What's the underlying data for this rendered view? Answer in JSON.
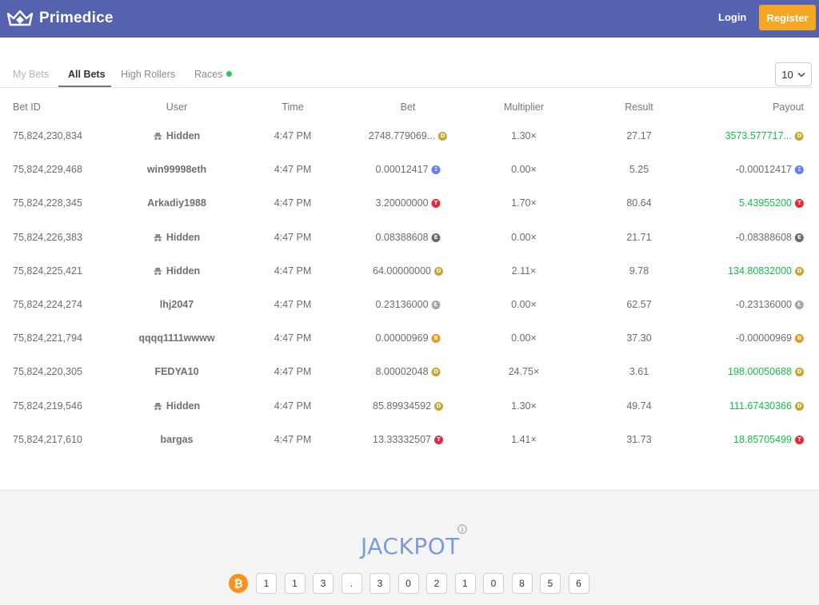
{
  "header": {
    "brand": "Primedice",
    "login_label": "Login",
    "register_label": "Register",
    "bar_color": "#5562ad",
    "register_color": "#f5a623"
  },
  "tabs": [
    {
      "label": "My Bets",
      "state": "disabled"
    },
    {
      "label": "All Bets",
      "state": "active"
    },
    {
      "label": "High Rollers",
      "state": "normal"
    },
    {
      "label": "Races",
      "state": "normal",
      "live_indicator": true
    }
  ],
  "rows_selector": {
    "value": "10",
    "icon": "chevron-down-icon"
  },
  "table": {
    "columns": [
      "Bet ID",
      "User",
      "Time",
      "Bet",
      "Multiplier",
      "Result",
      "Payout"
    ],
    "rows": [
      {
        "id": "75,824,230,834",
        "user": "Hidden",
        "hidden": true,
        "time": "4:47 PM",
        "bet": "2748.779069...",
        "coin": "doge",
        "multiplier": "1.30×",
        "result": "27.17",
        "payout": "3573.577717...",
        "positive": true
      },
      {
        "id": "75,824,229,468",
        "user": "win99998eth",
        "hidden": false,
        "time": "4:47 PM",
        "bet": "0.00012417",
        "coin": "eth",
        "multiplier": "0.00×",
        "result": "5.25",
        "payout": "-0.00012417",
        "positive": false
      },
      {
        "id": "75,824,228,345",
        "user": "Arkadiy1988",
        "hidden": false,
        "time": "4:47 PM",
        "bet": "3.20000000",
        "coin": "trx",
        "multiplier": "1.70×",
        "result": "80.64",
        "payout": "5.43955200",
        "positive": true
      },
      {
        "id": "75,824,226,383",
        "user": "Hidden",
        "hidden": true,
        "time": "4:47 PM",
        "bet": "0.08388608",
        "coin": "eos",
        "multiplier": "0.00×",
        "result": "21.71",
        "payout": "-0.08388608",
        "positive": false
      },
      {
        "id": "75,824,225,421",
        "user": "Hidden",
        "hidden": true,
        "time": "4:47 PM",
        "bet": "64.00000000",
        "coin": "doge",
        "multiplier": "2.11×",
        "result": "9.78",
        "payout": "134.80832000",
        "positive": true
      },
      {
        "id": "75,824,224,274",
        "user": "lhj2047",
        "hidden": false,
        "time": "4:47 PM",
        "bet": "0.23136000",
        "coin": "ltc",
        "multiplier": "0.00×",
        "result": "62.57",
        "payout": "-0.23136000",
        "positive": false
      },
      {
        "id": "75,824,221,794",
        "user": "qqqq1111wwww",
        "hidden": false,
        "time": "4:47 PM",
        "bet": "0.00000969",
        "coin": "btc",
        "multiplier": "0.00×",
        "result": "37.30",
        "payout": "-0.00000969",
        "positive": false
      },
      {
        "id": "75,824,220,305",
        "user": "FEDYA10",
        "hidden": false,
        "time": "4:47 PM",
        "bet": "8.00002048",
        "coin": "doge",
        "multiplier": "24.75×",
        "result": "3.61",
        "payout": "198.00050688",
        "positive": true
      },
      {
        "id": "75,824,219,546",
        "user": "Hidden",
        "hidden": true,
        "time": "4:47 PM",
        "bet": "85.89934592",
        "coin": "doge",
        "multiplier": "1.30×",
        "result": "49.74",
        "payout": "111.67430366",
        "positive": true
      },
      {
        "id": "75,824,217,610",
        "user": "bargas",
        "hidden": false,
        "time": "4:47 PM",
        "bet": "13.33332507",
        "coin": "trx",
        "multiplier": "1.41×",
        "result": "31.73",
        "payout": "18.85705499",
        "positive": true
      }
    ]
  },
  "coins": {
    "doge": {
      "color": "#c9a52f",
      "glyph": "D"
    },
    "eth": {
      "color": "#627eea",
      "glyph": "Ξ"
    },
    "trx": {
      "color": "#e8263a",
      "glyph": "T"
    },
    "eos": {
      "color": "#6b6b6b",
      "glyph": "E"
    },
    "ltc": {
      "color": "#a6a6a6",
      "glyph": "Ł"
    },
    "btc": {
      "color": "#f7931a",
      "glyph": "B"
    }
  },
  "colors": {
    "payout_positive": "#12c248",
    "jackpot_title": "#7f9ad9"
  },
  "jackpot": {
    "title": "JACKPOT",
    "currency_icon": "bitcoin-icon",
    "currency_glyph": "₿",
    "digits": [
      "1",
      "1",
      "3",
      ".",
      "3",
      "0",
      "2",
      "1",
      "0",
      "8",
      "5",
      "6"
    ]
  }
}
